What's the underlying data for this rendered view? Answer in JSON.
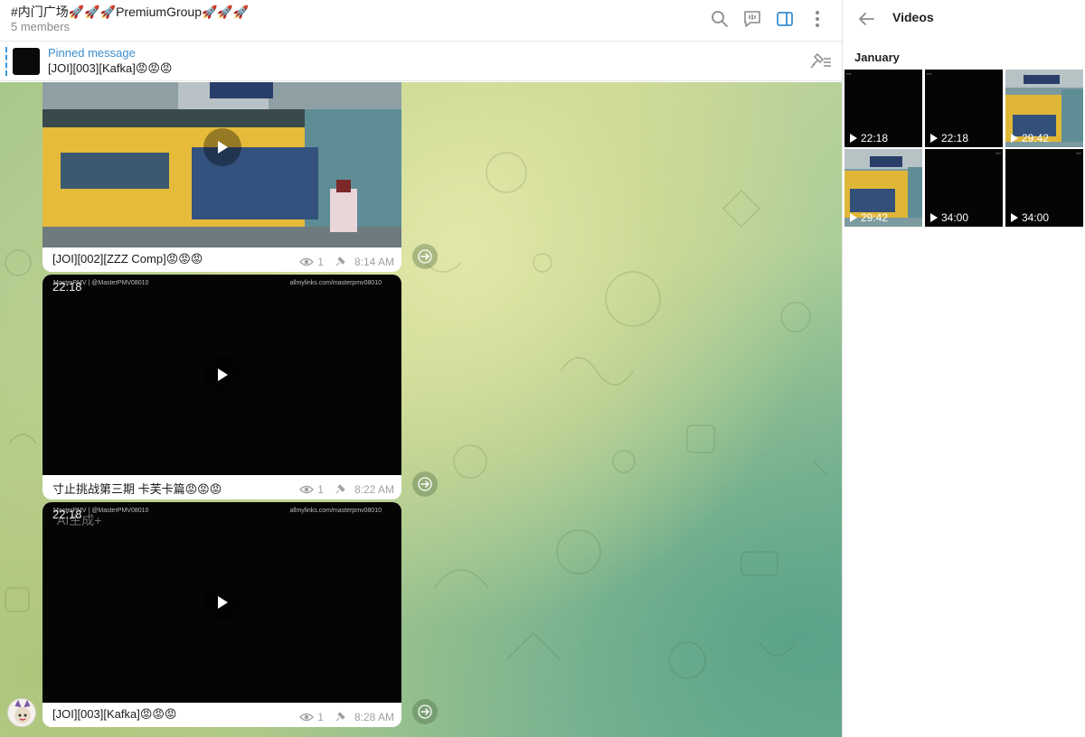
{
  "header": {
    "title": "#内门广场🚀🚀🚀PremiumGroup🚀🚀🚀",
    "subtitle": "5 members",
    "icons": [
      "search-icon",
      "video-chat-icon",
      "sidebar-toggle-icon",
      "more-vertical-icon"
    ]
  },
  "pinned": {
    "label": "Pinned message",
    "text": "[JOI][003][Kafka]😡😡😡",
    "icons": [
      "pin-list-icon"
    ]
  },
  "messages": [
    {
      "caption": "[JOI][002][ZZZ Comp]😡😡😡",
      "views": "1",
      "time": "8:14 AM",
      "thumbnail": "random-play-scene"
    },
    {
      "caption": "寸止挑战第三期  卡芙卡篇😡😡😡",
      "views": "1",
      "time": "8:22 AM",
      "duration": "22:18",
      "watermark_left": "MasterPMV | @MasterPMV08010",
      "watermark_right": "allmylinks.com/masterpmv08010"
    },
    {
      "caption": "[JOI][003][Kafka]😡😡😡",
      "views": "1",
      "time": "8:28 AM",
      "duration": "22:18",
      "overlay_text": "AI生成+",
      "watermark_left": "MasterPMV | @MasterPMV08010",
      "watermark_right": "allmylinks.com/masterpmv08010"
    }
  ],
  "side_panel": {
    "title": "Videos",
    "month": "January",
    "videos": [
      {
        "duration": "22:18",
        "thumb": "dark"
      },
      {
        "duration": "22:18",
        "thumb": "dark"
      },
      {
        "duration": "29:42",
        "thumb": "scene"
      },
      {
        "duration": "29:42",
        "thumb": "scene"
      },
      {
        "duration": "34:00",
        "thumb": "dark"
      },
      {
        "duration": "34:00",
        "thumb": "dark"
      }
    ]
  },
  "colors": {
    "accent": "#3a8fcf",
    "chat_bg_light": "#d4dc9c",
    "chat_bg_dark": "#7cb598"
  }
}
